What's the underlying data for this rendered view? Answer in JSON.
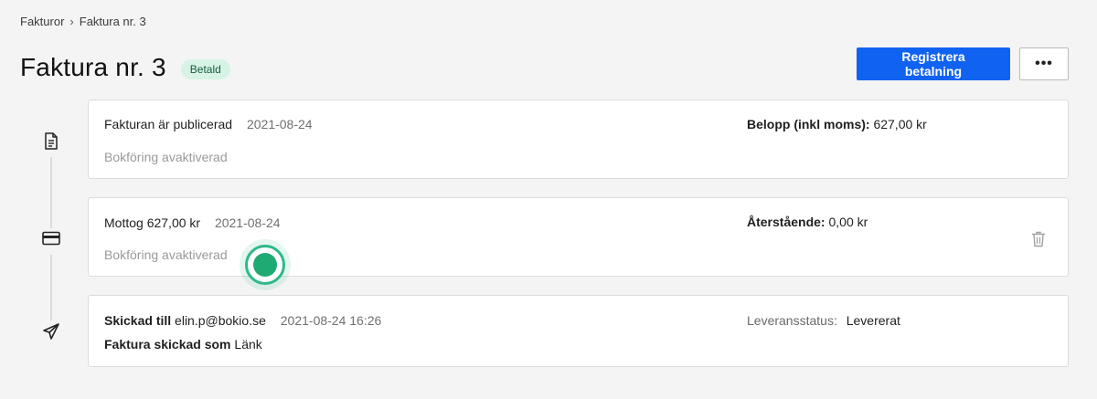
{
  "breadcrumb": {
    "parent": "Fakturor",
    "separator": "›",
    "current": "Faktura nr. 3"
  },
  "header": {
    "title": "Faktura nr. 3",
    "status_badge": "Betald",
    "primary_button": "Registrera betalning",
    "more_button": "•••"
  },
  "events": [
    {
      "icon": "document-icon",
      "title": "Fakturan är publicerad",
      "date": "2021-08-24",
      "subtitle": "Bokföring avaktiverad",
      "right_label": "Belopp (inkl moms):",
      "right_value": "627,00 kr"
    },
    {
      "icon": "credit-card-icon",
      "title": "Mottog 627,00 kr",
      "date": "2021-08-24",
      "subtitle": "Bokföring avaktiverad",
      "right_label": "Återstående:",
      "right_value": "0,00 kr",
      "has_delete": true
    },
    {
      "icon": "paper-plane-icon",
      "title_bold": "Skickad till",
      "title_rest": "elin.p@bokio.se",
      "date": "2021-08-24 16:26",
      "line2_bold": "Faktura skickad som",
      "line2_rest": "Länk",
      "right_label": "Leveransstatus:",
      "right_value": "Levererat"
    }
  ],
  "colors": {
    "primary": "#1062f0",
    "badge_bg": "#d6f3e6",
    "badge_text": "#1a5c41",
    "pulse": "#1faa74"
  }
}
